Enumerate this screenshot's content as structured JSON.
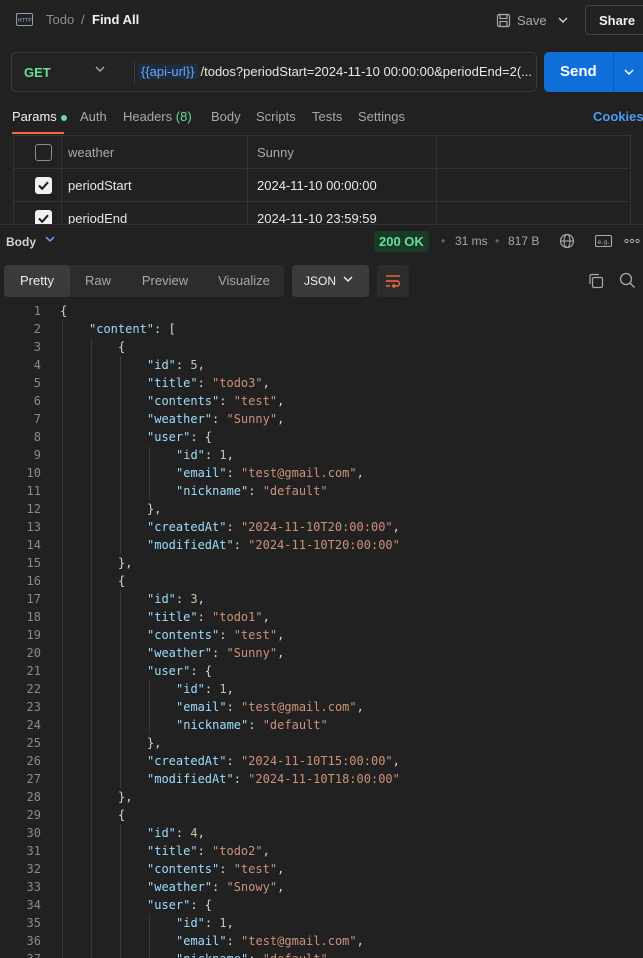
{
  "header": {
    "icon": "http-icon",
    "breadcrumb_parent": "Todo",
    "breadcrumb_sep": "/",
    "title": "Find All",
    "save_label": "Save",
    "share_label": "Share"
  },
  "request": {
    "method": "GET",
    "url_variable": "{{api-url}}",
    "url_rest": "/todos?periodStart=2024-11-10 00:00:00&periodEnd=2(...",
    "send_label": "Send"
  },
  "tabs": [
    {
      "label": "Params",
      "active": true
    },
    {
      "label": "Auth"
    },
    {
      "label": "Headers",
      "count": "(8)"
    },
    {
      "label": "Body"
    },
    {
      "label": "Scripts"
    },
    {
      "label": "Tests"
    },
    {
      "label": "Settings"
    }
  ],
  "cookies_label": "Cookies",
  "params": [
    {
      "checked": false,
      "key": "weather",
      "value": "Sunny"
    },
    {
      "checked": true,
      "key": "periodStart",
      "value": "2024-11-10 00:00:00"
    },
    {
      "checked": true,
      "key": "periodEnd",
      "value": "2024-11-10 23:59:59"
    }
  ],
  "response": {
    "section_label": "Body",
    "status": "200 OK",
    "time": "31 ms",
    "size": "817 B",
    "view_tabs": [
      "Pretty",
      "Raw",
      "Preview",
      "Visualize"
    ],
    "active_view": "Pretty",
    "format": "JSON"
  },
  "colors": {
    "accent": "#f26b3a",
    "send": "#0e6fd8",
    "status_ok": "#6bdd9a",
    "json_key": "#9cdcfe",
    "json_string": "#ce9178",
    "json_number": "#b5cea8"
  },
  "code_lines": [
    [
      [
        "p",
        "{"
      ]
    ],
    [
      [
        "k",
        "\"content\""
      ],
      [
        "p",
        ": ["
      ]
    ],
    [
      [
        "p",
        "{"
      ]
    ],
    [
      [
        "k",
        "\"id\""
      ],
      [
        "p",
        ": "
      ],
      [
        "n",
        "5"
      ],
      [
        "p",
        ","
      ]
    ],
    [
      [
        "k",
        "\"title\""
      ],
      [
        "p",
        ": "
      ],
      [
        "s",
        "\"todo3\""
      ],
      [
        "p",
        ","
      ]
    ],
    [
      [
        "k",
        "\"contents\""
      ],
      [
        "p",
        ": "
      ],
      [
        "s",
        "\"test\""
      ],
      [
        "p",
        ","
      ]
    ],
    [
      [
        "k",
        "\"weather\""
      ],
      [
        "p",
        ": "
      ],
      [
        "s",
        "\"Sunny\""
      ],
      [
        "p",
        ","
      ]
    ],
    [
      [
        "k",
        "\"user\""
      ],
      [
        "p",
        ": {"
      ]
    ],
    [
      [
        "k",
        "\"id\""
      ],
      [
        "p",
        ": "
      ],
      [
        "n",
        "1"
      ],
      [
        "p",
        ","
      ]
    ],
    [
      [
        "k",
        "\"email\""
      ],
      [
        "p",
        ": "
      ],
      [
        "s",
        "\"test@gmail.com\""
      ],
      [
        "p",
        ","
      ]
    ],
    [
      [
        "k",
        "\"nickname\""
      ],
      [
        "p",
        ": "
      ],
      [
        "s",
        "\"default\""
      ]
    ],
    [
      [
        "p",
        "},"
      ]
    ],
    [
      [
        "k",
        "\"createdAt\""
      ],
      [
        "p",
        ": "
      ],
      [
        "s",
        "\"2024-11-10T20:00:00\""
      ],
      [
        "p",
        ","
      ]
    ],
    [
      [
        "k",
        "\"modifiedAt\""
      ],
      [
        "p",
        ": "
      ],
      [
        "s",
        "\"2024-11-10T20:00:00\""
      ]
    ],
    [
      [
        "p",
        "},"
      ]
    ],
    [
      [
        "p",
        "{"
      ]
    ],
    [
      [
        "k",
        "\"id\""
      ],
      [
        "p",
        ": "
      ],
      [
        "n",
        "3"
      ],
      [
        "p",
        ","
      ]
    ],
    [
      [
        "k",
        "\"title\""
      ],
      [
        "p",
        ": "
      ],
      [
        "s",
        "\"todo1\""
      ],
      [
        "p",
        ","
      ]
    ],
    [
      [
        "k",
        "\"contents\""
      ],
      [
        "p",
        ": "
      ],
      [
        "s",
        "\"test\""
      ],
      [
        "p",
        ","
      ]
    ],
    [
      [
        "k",
        "\"weather\""
      ],
      [
        "p",
        ": "
      ],
      [
        "s",
        "\"Sunny\""
      ],
      [
        "p",
        ","
      ]
    ],
    [
      [
        "k",
        "\"user\""
      ],
      [
        "p",
        ": {"
      ]
    ],
    [
      [
        "k",
        "\"id\""
      ],
      [
        "p",
        ": "
      ],
      [
        "n",
        "1"
      ],
      [
        "p",
        ","
      ]
    ],
    [
      [
        "k",
        "\"email\""
      ],
      [
        "p",
        ": "
      ],
      [
        "s",
        "\"test@gmail.com\""
      ],
      [
        "p",
        ","
      ]
    ],
    [
      [
        "k",
        "\"nickname\""
      ],
      [
        "p",
        ": "
      ],
      [
        "s",
        "\"default\""
      ]
    ],
    [
      [
        "p",
        "},"
      ]
    ],
    [
      [
        "k",
        "\"createdAt\""
      ],
      [
        "p",
        ": "
      ],
      [
        "s",
        "\"2024-11-10T15:00:00\""
      ],
      [
        "p",
        ","
      ]
    ],
    [
      [
        "k",
        "\"modifiedAt\""
      ],
      [
        "p",
        ": "
      ],
      [
        "s",
        "\"2024-11-10T18:00:00\""
      ]
    ],
    [
      [
        "p",
        "},"
      ]
    ],
    [
      [
        "p",
        "{"
      ]
    ],
    [
      [
        "k",
        "\"id\""
      ],
      [
        "p",
        ": "
      ],
      [
        "n",
        "4"
      ],
      [
        "p",
        ","
      ]
    ],
    [
      [
        "k",
        "\"title\""
      ],
      [
        "p",
        ": "
      ],
      [
        "s",
        "\"todo2\""
      ],
      [
        "p",
        ","
      ]
    ],
    [
      [
        "k",
        "\"contents\""
      ],
      [
        "p",
        ": "
      ],
      [
        "s",
        "\"test\""
      ],
      [
        "p",
        ","
      ]
    ],
    [
      [
        "k",
        "\"weather\""
      ],
      [
        "p",
        ": "
      ],
      [
        "s",
        "\"Snowy\""
      ],
      [
        "p",
        ","
      ]
    ],
    [
      [
        "k",
        "\"user\""
      ],
      [
        "p",
        ": {"
      ]
    ],
    [
      [
        "k",
        "\"id\""
      ],
      [
        "p",
        ": "
      ],
      [
        "n",
        "1"
      ],
      [
        "p",
        ","
      ]
    ],
    [
      [
        "k",
        "\"email\""
      ],
      [
        "p",
        ": "
      ],
      [
        "s",
        "\"test@gmail.com\""
      ],
      [
        "p",
        ","
      ]
    ],
    [
      [
        "k",
        "\"nickname\""
      ],
      [
        "p",
        ": "
      ],
      [
        "s",
        "\"default\""
      ]
    ]
  ]
}
